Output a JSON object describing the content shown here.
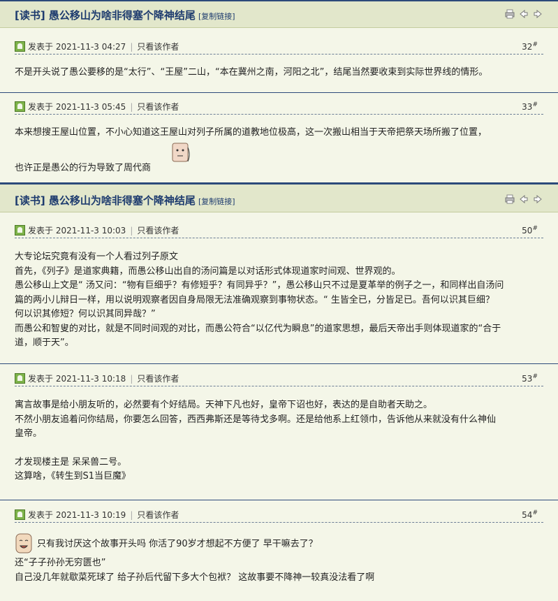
{
  "threads": [
    {
      "title": "[读书] 愚公移山为啥非得塞个降神结尾",
      "copy_link": "[复制链接]"
    },
    {
      "title": "[读书] 愚公移山为啥非得塞个降神结尾",
      "copy_link": "[复制链接]"
    }
  ],
  "only_author_label": "只看该作者",
  "posts": [
    {
      "posted": "发表于 2021-11-3 04:27",
      "floor": "32",
      "floor_mark": "#",
      "lines": [
        "不是开头说了愚公要移的是“太行”、“王屋”二山，“本在冀州之南，河阳之北”，结尾当然要收束到实际世界线的情形。"
      ]
    },
    {
      "posted": "发表于 2021-11-3 05:45",
      "floor": "33",
      "floor_mark": "#",
      "lines": [
        "本来想搜王屋山位置，不小心知道这王屋山对列子所属的道教地位极高，这一次搬山相当于天帝把祭天场所搬了位置，",
        "也许正是愚公的行为导致了周代商"
      ]
    },
    {
      "posted": "发表于 2021-11-3 10:03",
      "floor": "50",
      "floor_mark": "#",
      "lines": [
        "大专论坛究竟有没有一个人看过列子原文",
        "首先，《列子》是道家典籍，而愚公移山出自的汤问篇是以对话形式体现道家时间观、世界观的。",
        "愚公移山上文是“ 汤又问：“物有巨细乎？有修短乎？有同异乎？”，愚公移山只不过是夏革举的例子之一，和同样出自汤问",
        "篇的两小儿辩日一样，用以说明观察者因自身局限无法准确观察到事物状态。“ 生皆全已，分皆足已。吾何以识其巨细？",
        "何以识其修短？何以识其同异哉？”",
        "而愚公和智叟的对比，就是不同时间观的对比，而愚公符合“以亿代为瞬息”的道家思想，最后天帝出手则体现道家的“合于",
        "道，顺于天”。"
      ]
    },
    {
      "posted": "发表于 2021-11-3 10:18",
      "floor": "53",
      "floor_mark": "#",
      "lines": [
        "寓言故事是给小朋友听的，必然要有个好结局。天神下凡也好，皇帝下诏也好，表达的是自助者天助之。",
        "不然小朋友追着问你结局，你要怎么回答，西西弗斯还是等待戈多啊。还是给他系上红领巾，告诉他从来就没有什么神仙",
        "皇帝。",
        "",
        "才发现楼主是 呆呆兽二号。",
        "这算啥，《转生到S1当巨魔》"
      ]
    },
    {
      "posted": "发表于 2021-11-3 10:19",
      "floor": "54",
      "floor_mark": "#",
      "lines": [
        "只有我讨厌这个故事开头吗 你活了90岁才想起不方便了 早干嘛去了？",
        "还“子子孙孙无穷匮也”",
        "自己没几年就歇菜死球了 给子孙后代留下多大个包袱？ 这故事要不降神一较真没法看了啊"
      ]
    }
  ],
  "icons": [
    "print-icon",
    "arrow-left-icon",
    "arrow-right-icon",
    "user-avatar-icon",
    "emoticon-sweat-icon",
    "emoticon-smile-icon"
  ],
  "colors": {
    "header_bg": "#e2e7cb",
    "title": "#1d3b6e",
    "page_bg": "#f4f6e8",
    "divider": "#2c4a7a",
    "avatar": "#7eb34a"
  }
}
